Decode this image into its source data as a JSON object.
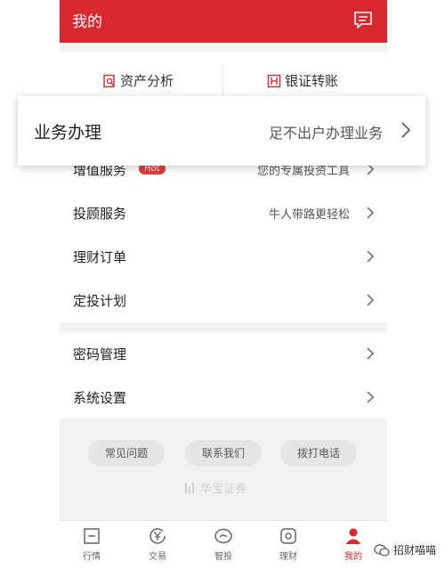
{
  "header": {
    "title": "我的",
    "icon": "message-icon"
  },
  "quick_actions": [
    {
      "label": "资产分析",
      "icon": "analysis-icon"
    },
    {
      "label": "银证转账",
      "icon": "transfer-icon"
    }
  ],
  "popup": {
    "label": "业务办理",
    "subtitle": "足不出户办理业务"
  },
  "menu": [
    {
      "label": "增值服务",
      "badge": "Hot",
      "subtitle": "您的专属投资工具"
    },
    {
      "label": "投顾服务",
      "subtitle": "牛人带路更轻松"
    },
    {
      "label": "理财订单",
      "subtitle": ""
    },
    {
      "label": "定投计划",
      "subtitle": ""
    }
  ],
  "settings": [
    {
      "label": "密码管理"
    },
    {
      "label": "系统设置"
    }
  ],
  "footer_buttons": [
    "常见问题",
    "联系我们",
    "拨打电话"
  ],
  "brand_logo": "华宝证券",
  "tabs": [
    {
      "label": "行情",
      "icon": "quotes-icon"
    },
    {
      "label": "交易",
      "icon": "yen-icon"
    },
    {
      "label": "智投",
      "icon": "smart-icon"
    },
    {
      "label": "理财",
      "icon": "finance-icon"
    },
    {
      "label": "我的",
      "icon": "user-icon",
      "active": true
    }
  ],
  "watermark": "招财喵喵",
  "colors": {
    "brand": "#d9282f",
    "background": "#f2f2f2"
  }
}
